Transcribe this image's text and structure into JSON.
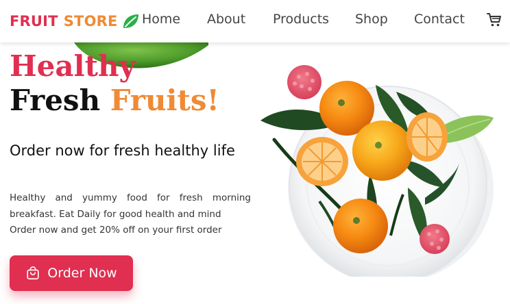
{
  "brand": {
    "part1": "FRUIT",
    "part2": "STORE",
    "icon": "leaf-icon",
    "color1": "#e02f50",
    "color2": "#f08a35"
  },
  "nav": {
    "links": [
      "Home",
      "About",
      "Products",
      "Shop",
      "Contact"
    ],
    "cart_icon": "cart-icon"
  },
  "hero": {
    "title_line1": "Healthy",
    "title_line2_a": "Fresh",
    "title_line2_b": "Fruits!",
    "subtitle": "Order now for fresh healthy life",
    "description": [
      "Healthy and yummy food for fresh morning breakfast. Eat Daily for good health and mind",
      "Order now and get 20% off on your first order"
    ],
    "cta_label": "Order Now",
    "cta_icon": "shopping-bag-icon",
    "image": "plate-of-oranges-image"
  },
  "colors": {
    "accent": "#e02f50",
    "orange": "#f08a35",
    "nav_text": "#444444"
  }
}
